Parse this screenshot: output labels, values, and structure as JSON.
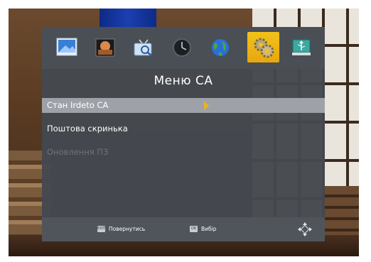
{
  "menu": {
    "title": "Меню CA",
    "items": [
      {
        "label": "Стан Irdeto CA",
        "state": "selected"
      },
      {
        "label": "Поштова скринька",
        "state": "normal"
      },
      {
        "label": "Оновлення ПЗ",
        "state": "disabled"
      }
    ]
  },
  "tabs": [
    {
      "icon": "picture-icon"
    },
    {
      "icon": "photo-icon"
    },
    {
      "icon": "tv-search-icon"
    },
    {
      "icon": "clock-icon"
    },
    {
      "icon": "globe-icon"
    },
    {
      "icon": "gear-icon",
      "active": true
    },
    {
      "icon": "usb-icon"
    }
  ],
  "hints": {
    "back_key": "EXIT",
    "back_label": "Повернутись",
    "ok_key": "OK",
    "ok_label": "Вибір"
  },
  "colors": {
    "panel": "#44484e",
    "selected_row": "#9ea2a8",
    "accent": "#f2b11a"
  }
}
